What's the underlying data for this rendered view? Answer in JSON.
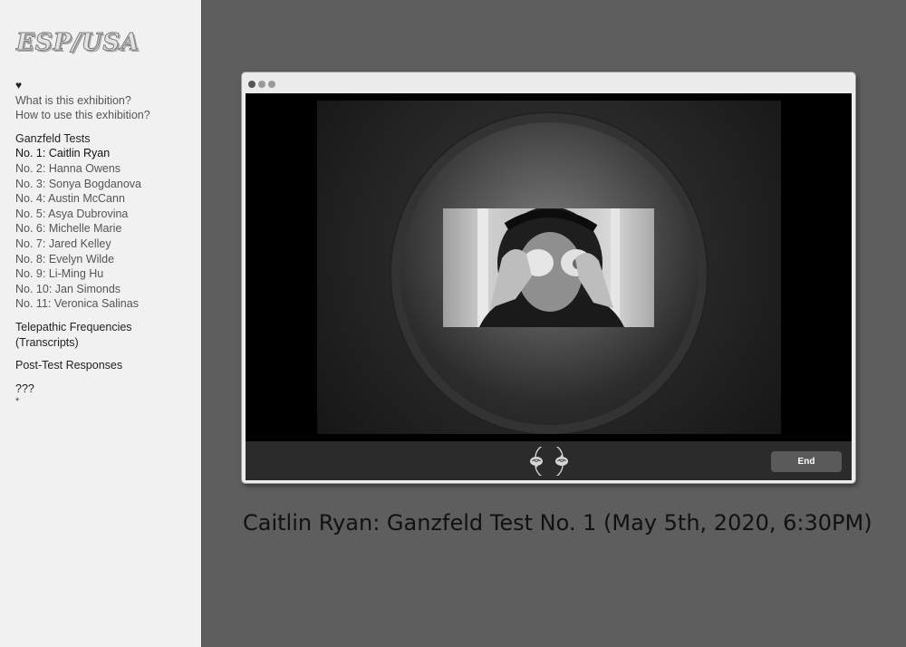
{
  "logo": {
    "text": "ESP/USA"
  },
  "nav": {
    "heart": "♥",
    "about_links": [
      "What is this exhibition?",
      "How to use this exhibition?"
    ],
    "ganzfeld_heading": "Ganzfeld Tests",
    "tests": [
      "No. 1: Caitlin Ryan",
      "No. 2: Hanna Owens",
      "No. 3: Sonya Bogdanova",
      "No. 4: Austin McCann",
      "No. 5: Asya Dubrovina",
      "No. 6: Michelle Marie",
      "No. 7: Jared Kelley",
      "No. 8: Evelyn Wilde",
      "No. 9: Li-Ming Hu",
      "No. 10: Jan Simonds",
      "No. 11: Veronica Salinas"
    ],
    "current_test_index": 0,
    "telepathic_line1": "Telepathic Frequencies",
    "telepathic_line2": "(Transcripts)",
    "post_test": "Post-Test Responses",
    "mystery": "???",
    "asterisk": "*"
  },
  "player": {
    "end_label": "End",
    "swap_icon": "brain-swap-icon"
  },
  "caption": "Caitlin Ryan: Ganzfeld Test No. 1 (May 5th, 2020, 6:30PM)"
}
